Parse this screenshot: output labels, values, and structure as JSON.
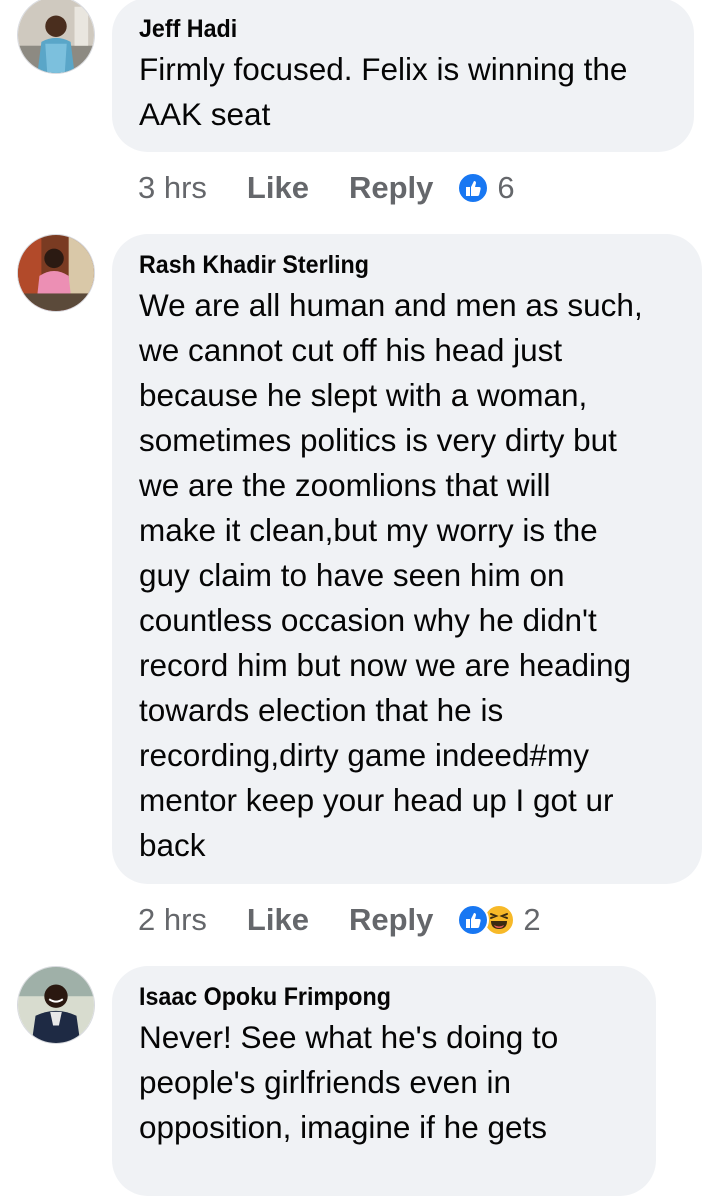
{
  "comments": [
    {
      "name": "Jeff Hadi",
      "text": "Firmly focused. Felix is winning the\nAAK seat",
      "time": "3 hrs",
      "like_label": "Like",
      "reply_label": "Reply",
      "reaction_icons": [
        "like-reaction-icon"
      ],
      "reaction_count": "6"
    },
    {
      "name": "Rash Khadir Sterling",
      "text": "We are all human and men as such,\nwe cannot cut off his head just\nbecause he slept with a woman,\nsometimes politics is very dirty but\nwe are the zoomlions that will\nmake it clean,but my worry is the\nguy claim to have seen him on\ncountless occasion why he didn't\nrecord him but now we are heading\ntowards election that he is\nrecording,dirty game indeed#my\nmentor keep your head up I got ur\nback",
      "time": "2 hrs",
      "like_label": "Like",
      "reply_label": "Reply",
      "reaction_icons": [
        "like-reaction-icon",
        "haha-reaction-icon"
      ],
      "reaction_count": "2"
    },
    {
      "name": "Isaac Opoku Frimpong",
      "text": "Never! See what he's doing to\npeople's girlfriends even in\nopposition, imagine if he gets",
      "time": "",
      "like_label": "",
      "reply_label": "",
      "reaction_count": ""
    }
  ],
  "colors": {
    "bubble": "#f0f2f5",
    "text": "#050505",
    "meta": "#65676b",
    "like_blue": "#1877f2",
    "haha_yellow": "#f7b928"
  }
}
